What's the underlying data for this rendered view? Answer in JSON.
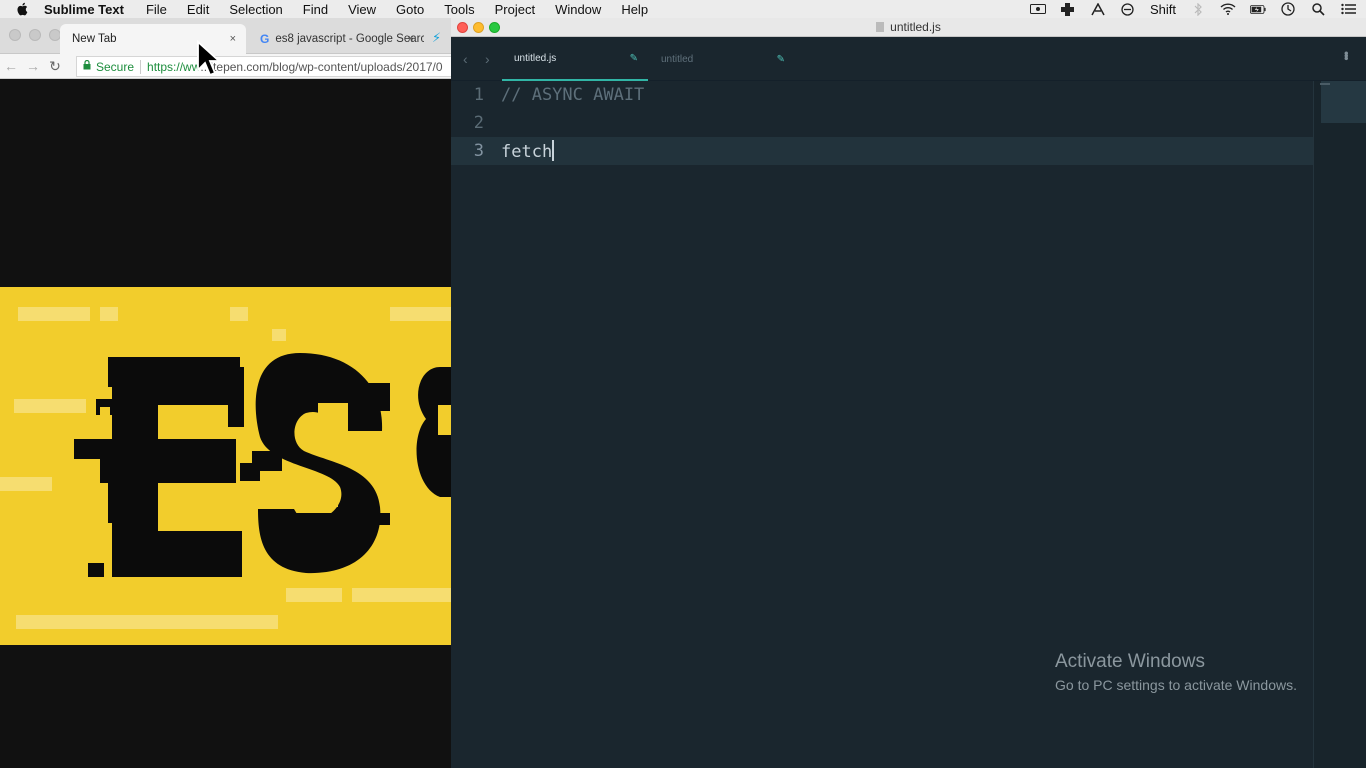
{
  "menubar": {
    "app": "Sublime Text",
    "items": [
      "File",
      "Edit",
      "Selection",
      "Find",
      "View",
      "Goto",
      "Tools",
      "Project",
      "Window",
      "Help"
    ],
    "status_keyboard": "Shift"
  },
  "browser": {
    "tabs": [
      {
        "title": "New Tab",
        "close": "×"
      },
      {
        "title": "es8 javascript - Google Searc",
        "close": "×"
      }
    ],
    "address": {
      "secure_label": "Secure",
      "protocol": "https://ww",
      "rest": "...itepen.com/blog/wp-content/uploads/2017/0"
    }
  },
  "sublime": {
    "window_title": "untitled.js",
    "tabs": [
      {
        "label": "untitled.js",
        "active": true
      },
      {
        "label": "untitled",
        "active": false
      }
    ],
    "lines": [
      {
        "number": "1",
        "text": "// ASYNC AWAIT",
        "type": "comment"
      },
      {
        "number": "2",
        "text": "",
        "type": "code"
      },
      {
        "number": "3",
        "text": "fetch",
        "type": "code"
      }
    ]
  },
  "watermark": {
    "title": "Activate Windows",
    "subtitle": "Go to PC settings to activate Windows."
  },
  "colors": {
    "banner_yellow": "#f2cd2c",
    "editor_bg": "#1a262e",
    "tab_accent": "#31b5a6"
  }
}
